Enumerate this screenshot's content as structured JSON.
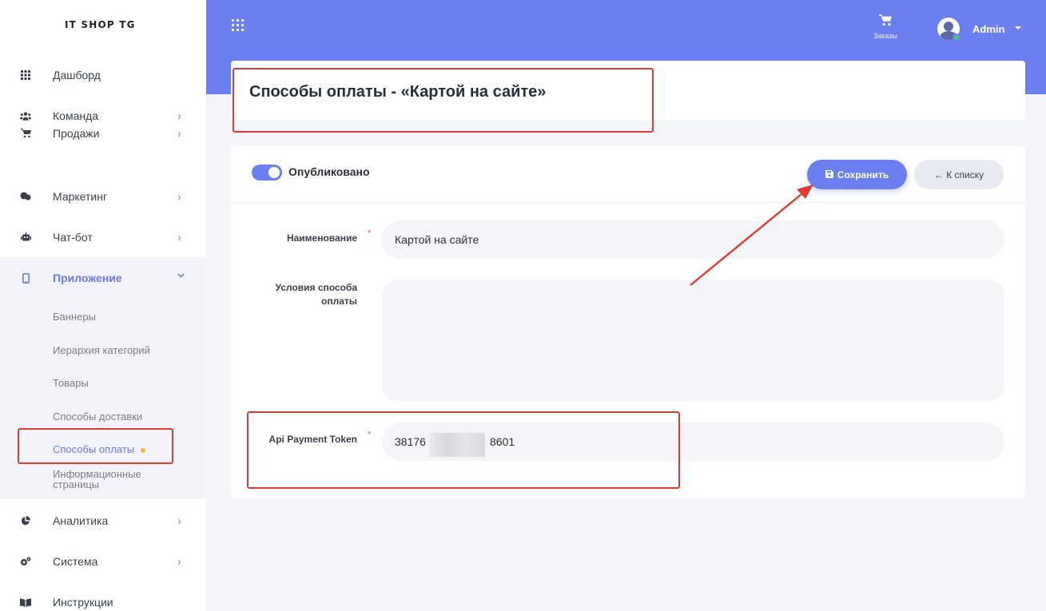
{
  "brand": "IT SHOP TG",
  "sidebar": {
    "items": [
      {
        "label": "Дашборд",
        "icon": "grid-icon",
        "chevron": ""
      },
      {
        "label": "Команда",
        "icon": "users-icon",
        "chevron": "›"
      },
      {
        "label": "Продажи",
        "icon": "cart-icon",
        "chevron": "›"
      },
      {
        "label": "Маркетинг",
        "icon": "megaphone-icon",
        "chevron": "›"
      },
      {
        "label": "Чат-бот",
        "icon": "robot-icon",
        "chevron": "›"
      },
      {
        "label": "Приложение",
        "icon": "mobile-icon",
        "chevron": "⌄"
      },
      {
        "label": "Аналитика",
        "icon": "pie-chart-icon",
        "chevron": "›"
      },
      {
        "label": "Система",
        "icon": "cogs-icon",
        "chevron": "›"
      },
      {
        "label": "Инструкции",
        "icon": "book-icon",
        "chevron": ""
      }
    ],
    "subitems": [
      {
        "label": "Баннеры"
      },
      {
        "label": "Иерархия категорий"
      },
      {
        "label": "Товары"
      },
      {
        "label": "Способы доставки"
      },
      {
        "label": "Способы оплаты"
      },
      {
        "label_line1": "Информационные",
        "label_line2": "страницы"
      }
    ]
  },
  "header": {
    "orders_label": "Заказы",
    "user_name": "Admin"
  },
  "page": {
    "title": "Способы оплаты - «Картой на сайте»"
  },
  "form": {
    "published_label": "Опубликовано",
    "published": true,
    "save_label": "Сохранить",
    "back_label": "← К списку",
    "name_label": "Наименование",
    "name_value": "Картой на сайте",
    "conditions_label_line1": "Условия способа",
    "conditions_label_line2": "оплаты",
    "conditions_value": "",
    "token_label": "Api Payment Token",
    "token_prefix": "38176",
    "token_suffix": "8601",
    "required_mark": "*"
  },
  "colors": {
    "accent": "#6c7ff0",
    "highlight": "#e03b33",
    "badge_dot": "#f5b64b"
  }
}
